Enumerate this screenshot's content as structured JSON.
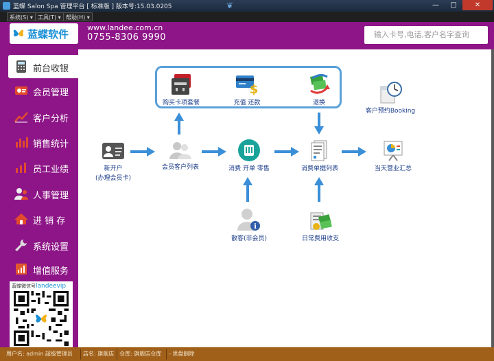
{
  "window": {
    "title": "蓝蝶 Salon Spa 管理平台 [ 标准版 ] 版本号:15.03.0205",
    "minimize": "—",
    "maximize": "□",
    "close": "✕"
  },
  "menu": [
    {
      "label": "系统(S) ▾"
    },
    {
      "label": "工具(T) ▾"
    },
    {
      "label": "帮助(H) ▾"
    }
  ],
  "header": {
    "logo_text": "蓝蝶软件",
    "url": "www.landee.com.cn",
    "phone": "0755-8306 9990",
    "search_placeholder": "输入卡号,电话,客户名字查询"
  },
  "sidebar": {
    "items": [
      {
        "label": "前台收银",
        "icon": "calculator-icon",
        "active": true
      },
      {
        "label": "会员管理",
        "icon": "member-card-icon"
      },
      {
        "label": "客户分析",
        "icon": "line-chart-icon"
      },
      {
        "label": "销售统计",
        "icon": "bar-chart-icon"
      },
      {
        "label": "员工业绩",
        "icon": "staff-chart-icon"
      },
      {
        "label": "人事管理",
        "icon": "people-icon"
      },
      {
        "label": "进 销 存",
        "icon": "house-icon"
      },
      {
        "label": "系统设置",
        "icon": "wrench-icon"
      },
      {
        "label": "增值服务",
        "icon": "value-added-icon"
      }
    ],
    "qr_label": "蓝蝶微信号",
    "qr_handle": "landeevip"
  },
  "flow": {
    "new_account": "新开户",
    "new_account_sub": "(办理会员卡)",
    "member_list": "会员客户列表",
    "buy_package": "购买卡项套餐",
    "recharge": "充值 还款",
    "exchange": "退换",
    "consume": "消费 开单 零售",
    "consume_list": "消费单据列表",
    "booking": "客户预约Booking",
    "daily_summary": "当天营业汇总",
    "guest": "散客(非会员)",
    "daily_expense": "日常费用收支"
  },
  "status": {
    "user": "用户名: admin 超级管理员",
    "store": "店名: 旗舰店",
    "warehouse": "仓库: 旗舰店仓库",
    "extra": "-  思盘删除"
  },
  "colors": {
    "brand_purple": "#8d1587",
    "accent_blue": "#1a8fd6",
    "arrow_blue": "#3a8fd8",
    "status_brown": "#a0601a"
  }
}
